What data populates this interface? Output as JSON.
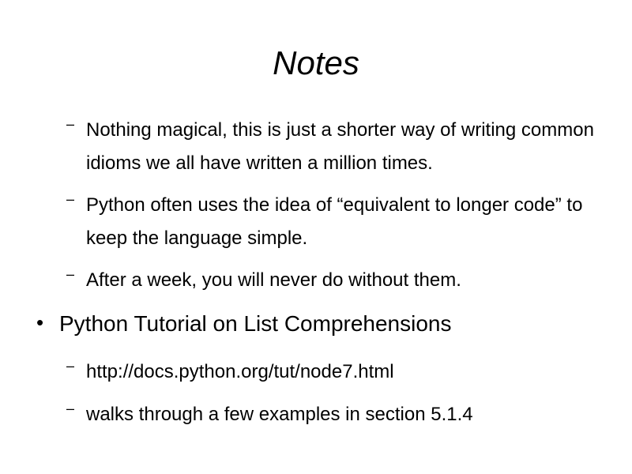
{
  "slide": {
    "title": "Notes",
    "items": [
      {
        "marker": "–",
        "text": "Nothing magical, this is just a shorter way of writing common idioms we all have written a million times."
      },
      {
        "marker": "–",
        "text": "Python often uses the idea of “equivalent to longer code” to keep the language simple."
      },
      {
        "marker": "–",
        "text": "After a week, you will never do without them."
      },
      {
        "marker": "•",
        "text": "Python Tutorial on List Comprehensions"
      },
      {
        "marker": "–",
        "text": "http://docs.python.org/tut/node7.html"
      },
      {
        "marker": "–",
        "text": "walks through a few examples in section 5.1.4"
      }
    ]
  }
}
